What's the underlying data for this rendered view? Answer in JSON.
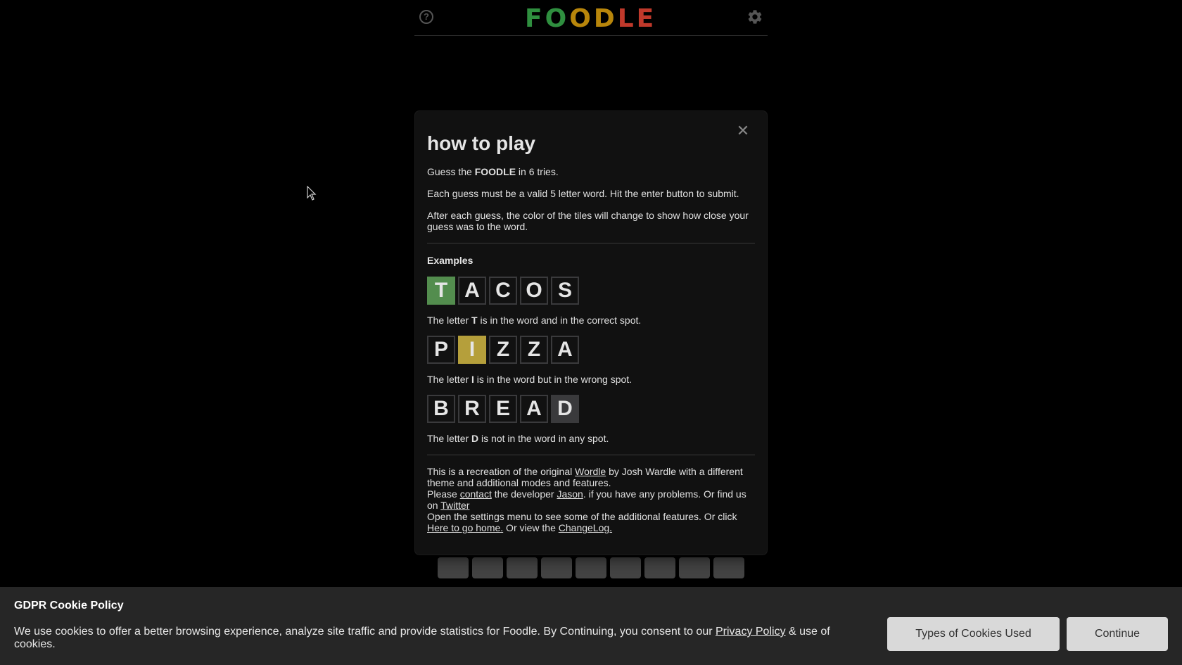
{
  "header": {
    "logo_letters": [
      {
        "char": "F",
        "color": "#2f8f3f"
      },
      {
        "char": "O",
        "color": "#2f8f3f"
      },
      {
        "char": "O",
        "color": "#b8860b"
      },
      {
        "char": "D",
        "color": "#b8860b"
      },
      {
        "char": "L",
        "color": "#c0392b"
      },
      {
        "char": "E",
        "color": "#c0392b"
      }
    ],
    "logo_text": "FOODLE",
    "help_icon": "help-circle-icon",
    "settings_icon": "gear-icon"
  },
  "modal": {
    "title": "how to play",
    "intro_prefix": "Guess the ",
    "intro_bold": "FOODLE",
    "intro_suffix": " in 6 tries.",
    "rule1": "Each guess must be a valid 5 letter word. Hit the enter button to submit.",
    "rule2": "After each guess, the color of the tiles will change to show how close your guess was to the word.",
    "examples_title": "Examples",
    "example1": {
      "tiles": [
        "T",
        "A",
        "C",
        "O",
        "S"
      ],
      "desc_prefix": "The letter ",
      "desc_letter": "T",
      "desc_suffix": " is in the word and in the correct spot."
    },
    "example2": {
      "tiles": [
        "P",
        "I",
        "Z",
        "Z",
        "A"
      ],
      "desc_prefix": "The letter ",
      "desc_letter": "I",
      "desc_suffix": " is in the word but in the wrong spot."
    },
    "example3": {
      "tiles": [
        "B",
        "R",
        "E",
        "A",
        "D"
      ],
      "desc_prefix": "The letter ",
      "desc_letter": "D",
      "desc_suffix": " is not in the word in any spot."
    },
    "footer": {
      "t1": "This is a recreation of the original ",
      "link_wordle": "Wordle",
      "t2": " by Josh Wardle with a different theme and additional modes and features.",
      "t3": "Please ",
      "link_contact": "contact",
      "t4": " the developer ",
      "link_jason": "Jason",
      "t5": ". if you have any problems. Or find us on ",
      "link_twitter": "Twitter",
      "t6": "Open the settings menu to see some of the additional features. Or click ",
      "link_home": "Here to go home.",
      "t7": " Or view the ",
      "link_changelog": "ChangeLog."
    },
    "close_icon": "close-icon"
  },
  "cookie": {
    "title": "GDPR Cookie Policy",
    "text_prefix": "We use cookies to offer a better browsing experience, analyze site traffic and provide statistics for Foodle. By Continuing, you consent to our ",
    "link_privacy": "Privacy Policy",
    "text_suffix": " & use of cookies.",
    "btn_types": "Types of Cookies Used",
    "btn_continue": "Continue"
  },
  "colors": {
    "correct": "#538d4e",
    "present": "#b59f3b",
    "absent": "#3a3a3c"
  }
}
